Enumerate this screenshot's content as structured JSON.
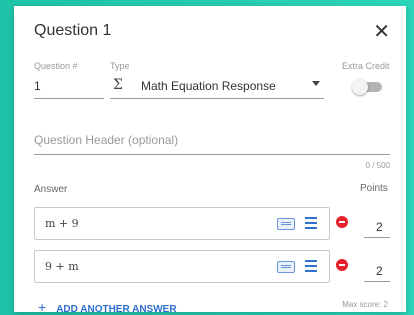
{
  "dialog": {
    "title": "Question 1",
    "close_icon": "close-icon"
  },
  "fields": {
    "question_number_label": "Question #",
    "question_number_value": "1",
    "type_label": "Type",
    "type_icon": "sigma-icon",
    "type_value": "Math Equation Response",
    "extra_credit_label": "Extra Credit",
    "extra_credit_on": false
  },
  "header": {
    "placeholder": "Question Header (optional)",
    "char_count": "0 / 500"
  },
  "answers_section": {
    "answer_label": "Answer",
    "points_label": "Points",
    "answers": [
      {
        "expression": "m + 9",
        "points": "2"
      },
      {
        "expression": "9 + m",
        "points": "2"
      }
    ],
    "add_answer_label": "ADD ANOTHER ANSWER",
    "max_score": "Max score: 2"
  },
  "colors": {
    "accent": "#2f6fd0",
    "remove": "#e8202a",
    "background": "#1ec3a8"
  }
}
